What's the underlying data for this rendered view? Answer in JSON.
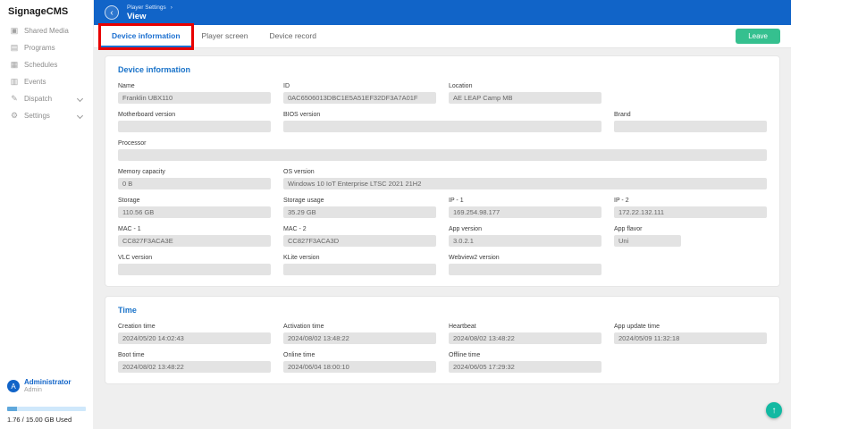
{
  "colors": {
    "header_blue": "#1164c8",
    "accent_blue": "#1b6fd0",
    "leave_green": "#35c08f",
    "fab_teal": "#12b9a2",
    "annotation_red": "#e80000",
    "field_gray": "#e3e3e3"
  },
  "sidebar": {
    "brand": "SignageCMS",
    "items": [
      {
        "label": "Shared Media",
        "icon": "▣"
      },
      {
        "label": "Programs",
        "icon": "▤"
      },
      {
        "label": "Schedules",
        "icon": "▦"
      },
      {
        "label": "Events",
        "icon": "▥"
      },
      {
        "label": "Dispatch",
        "icon": "✎",
        "expandable": true
      },
      {
        "label": "Settings",
        "icon": "⚙",
        "expandable": true
      }
    ],
    "user": {
      "avatar_letter": "A",
      "name": "Administrator",
      "role": "Admin"
    },
    "storage": {
      "label": "1.76 / 15.00 GB Used",
      "percent_used": 11.7
    }
  },
  "header": {
    "back_icon": "‹",
    "breadcrumb": "Player Settings",
    "breadcrumb_separator": "›",
    "title": "View"
  },
  "tab_bar": {
    "tabs": [
      {
        "label": "Device information",
        "active": true
      },
      {
        "label": "Player screen",
        "active": false
      },
      {
        "label": "Device record",
        "active": false
      }
    ],
    "leave_button": "Leave"
  },
  "device_info": {
    "section_title": "Device information",
    "fields": [
      {
        "label": "Name",
        "value": "Franklin UBX110"
      },
      {
        "label": "ID",
        "value": "0AC6506013DBC1E5A51EF32DF3A7A01F"
      },
      {
        "label": "Location",
        "value": "AE LEAP Camp MB"
      },
      {
        "label": "Motherboard version",
        "value": ""
      },
      {
        "label": "BIOS version",
        "value": ""
      },
      {
        "label": "Brand",
        "value": ""
      },
      {
        "label": "Processor",
        "value": ""
      },
      {
        "label": "Memory capacity",
        "value": "0 B"
      },
      {
        "label": "OS version",
        "value": "Windows 10 IoT Enterprise LTSC 2021 21H2"
      },
      {
        "label": "Storage",
        "value": "110.56 GB"
      },
      {
        "label": "Storage usage",
        "value": "35.29 GB"
      },
      {
        "label": "IP - 1",
        "value": "169.254.98.177"
      },
      {
        "label": "IP - 2",
        "value": "172.22.132.111"
      },
      {
        "label": "MAC - 1",
        "value": "CC827F3ACA3E"
      },
      {
        "label": "MAC - 2",
        "value": "CC827F3ACA3D"
      },
      {
        "label": "App version",
        "value": "3.0.2.1"
      },
      {
        "label": "App flavor",
        "value": "Uni"
      },
      {
        "label": "VLC version",
        "value": ""
      },
      {
        "label": "KLite version",
        "value": ""
      },
      {
        "label": "Webview2 version",
        "value": ""
      }
    ]
  },
  "time": {
    "section_title": "Time",
    "fields": [
      {
        "label": "Creation time",
        "value": "2024/05/20 14:02:43"
      },
      {
        "label": "Activation time",
        "value": "2024/08/02 13:48:22"
      },
      {
        "label": "Heartbeat",
        "value": "2024/08/02 13:48:22"
      },
      {
        "label": "App update time",
        "value": "2024/05/09 11:32:18"
      },
      {
        "label": "Boot time",
        "value": "2024/08/02 13:48:22"
      },
      {
        "label": "Online time",
        "value": "2024/06/04 18:00:10"
      },
      {
        "label": "Offline time",
        "value": "2024/06/05 17:29:32"
      }
    ]
  },
  "fab": {
    "icon": "↑"
  }
}
